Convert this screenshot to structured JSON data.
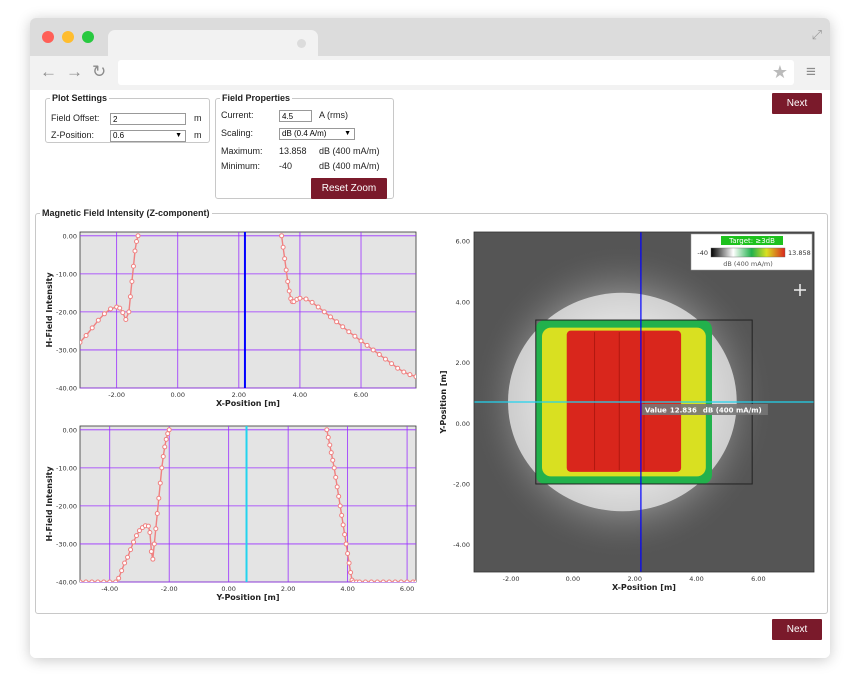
{
  "plot_settings": {
    "legend": "Plot Settings",
    "field_offset_label": "Field Offset:",
    "field_offset_value": "2",
    "field_offset_unit": "m",
    "z_position_label": "Z-Position:",
    "z_position_value": "0.6",
    "z_position_unit": "m"
  },
  "field_properties": {
    "legend": "Field Properties",
    "current_label": "Current:",
    "current_value": "4.5",
    "current_unit": "A (rms)",
    "scaling_label": "Scaling:",
    "scaling_value": "dB (0.4 A/m)",
    "maximum_label": "Maximum:",
    "maximum_value": "13.858",
    "maximum_unit": "dB (400 mA/m)",
    "minimum_label": "Minimum:",
    "minimum_value": "-40",
    "minimum_unit": "dB (400 mA/m)",
    "reset_zoom_label": "Reset Zoom"
  },
  "next_label": "Next",
  "chart_section": {
    "legend": "Magnetic Field Intensity (Z-component)"
  },
  "colors": {
    "button": "#7a1a2b",
    "curve": "#f08080",
    "grid": "#9b30ff",
    "cursor_x": "#0000ff",
    "cursor_y": "#22d3ee"
  },
  "icons": {
    "back": "back-arrow-icon",
    "forward": "forward-arrow-icon",
    "reload": "reload-icon",
    "star": "star-icon",
    "menu": "menu-icon",
    "expand": "expand-icon",
    "crosshair": "crosshair-icon"
  },
  "chart_data": [
    {
      "type": "line",
      "xlabel": "X-Position [m]",
      "ylabel": "H-Field Intensity",
      "xlim": [
        -3.2,
        7.8
      ],
      "ylim": [
        -40,
        1
      ],
      "xticks": [
        -2,
        0,
        2,
        4,
        6
      ],
      "xtick_labels": [
        "-2.00",
        "0.00",
        "2.00",
        "4.00",
        "6.00"
      ],
      "yticks": [
        0,
        -10,
        -20,
        -30,
        -40
      ],
      "ytick_labels": [
        "0.00",
        "-10.00",
        "-20.00",
        "-30.00",
        "-40.00"
      ],
      "grid": true,
      "cursor_x": 2.2,
      "series": [
        {
          "x": [
            -3.2,
            -3.0,
            -2.8,
            -2.6,
            -2.4,
            -2.2,
            -2.0,
            -1.9,
            -1.8,
            -1.7,
            -1.6,
            -1.55,
            -1.5,
            -1.45,
            -1.4,
            -1.35,
            -1.3
          ],
          "y": [
            -28,
            -26.2,
            -24.2,
            -22.2,
            -20.5,
            -19.2,
            -18.7,
            -19,
            -20.2,
            -22,
            -20,
            -16,
            -12,
            -8,
            -4,
            -1.5,
            0
          ]
        },
        {
          "x": [
            3.4,
            3.45,
            3.5,
            3.55,
            3.6,
            3.65,
            3.7,
            3.75,
            3.8,
            3.9,
            4.0,
            4.2,
            4.4,
            4.6,
            4.8,
            5.0,
            5.2,
            5.4,
            5.6,
            5.8,
            6.0,
            6.2,
            6.4,
            6.6,
            6.8,
            7.0,
            7.2,
            7.4,
            7.6,
            7.8
          ],
          "y": [
            0,
            -3,
            -6,
            -9,
            -12,
            -14.5,
            -16.5,
            -17.3,
            -17.3,
            -16.7,
            -16.4,
            -16.6,
            -17.5,
            -18.7,
            -20,
            -21.3,
            -22.6,
            -23.9,
            -25.2,
            -26.4,
            -27.6,
            -28.8,
            -30,
            -31.2,
            -32.4,
            -33.6,
            -34.8,
            -35.8,
            -36.5,
            -37
          ]
        }
      ]
    },
    {
      "type": "line",
      "xlabel": "Y-Position [m]",
      "ylabel": "H-Field Intensity",
      "xlim": [
        -5,
        6.3
      ],
      "ylim": [
        -40,
        1
      ],
      "xticks": [
        -4,
        -2,
        0,
        2,
        4,
        6
      ],
      "xtick_labels": [
        "-4.00",
        "-2.00",
        "0.00",
        "2.00",
        "4.00",
        "6.00"
      ],
      "yticks": [
        0,
        -10,
        -20,
        -30,
        -40
      ],
      "ytick_labels": [
        "0.00",
        "-10.00",
        "-20.00",
        "-30.00",
        "-40.00"
      ],
      "grid": true,
      "cursor_x": 0.6,
      "series": [
        {
          "x": [
            -5,
            -4.8,
            -4.6,
            -4.4,
            -4.2,
            -4.0,
            -3.8,
            -3.7,
            -3.6,
            -3.5,
            -3.4,
            -3.3,
            -3.2,
            -3.1,
            -3.0,
            -2.9,
            -2.8,
            -2.7,
            -2.65,
            -2.6,
            -2.55,
            -2.5,
            -2.45,
            -2.4,
            -2.35,
            -2.3,
            -2.25,
            -2.2,
            -2.15,
            -2.1,
            -2.05,
            -2.0
          ],
          "y": [
            -40,
            -40,
            -40,
            -40,
            -40,
            -40,
            -40,
            -39,
            -37,
            -35,
            -33.5,
            -31.5,
            -29.5,
            -27.8,
            -26.5,
            -25.7,
            -25.2,
            -25.3,
            -27,
            -32,
            -34,
            -30,
            -26,
            -22,
            -18,
            -14,
            -10,
            -7,
            -4.5,
            -2.5,
            -1,
            0
          ]
        },
        {
          "x": [
            3.3,
            3.35,
            3.4,
            3.45,
            3.5,
            3.55,
            3.6,
            3.65,
            3.7,
            3.75,
            3.8,
            3.85,
            3.9,
            3.95,
            4.0,
            4.05,
            4.1,
            4.15,
            4.2,
            4.3,
            4.4,
            4.6,
            4.8,
            5.0,
            5.2,
            5.4,
            5.6,
            5.8,
            6.0,
            6.2,
            6.3
          ],
          "y": [
            0,
            -2,
            -4,
            -6,
            -8,
            -10,
            -12.5,
            -15,
            -17.5,
            -20,
            -22.5,
            -25,
            -27.5,
            -30,
            -32.5,
            -35,
            -37.5,
            -39.5,
            -40,
            -40,
            -40,
            -40,
            -40,
            -40,
            -40,
            -40,
            -40,
            -40,
            -40,
            -40,
            -40
          ]
        }
      ]
    },
    {
      "type": "heatmap",
      "xlabel": "X-Position [m]",
      "ylabel": "Y-Position [m]",
      "xlim": [
        -3.2,
        7.8
      ],
      "ylim": [
        -4.9,
        6.3
      ],
      "xticks": [
        -2,
        0,
        2,
        4,
        6
      ],
      "xtick_labels": [
        "-2.00",
        "0.00",
        "2.00",
        "4.00",
        "6.00"
      ],
      "yticks": [
        6,
        4,
        2,
        0,
        -2,
        -4
      ],
      "ytick_labels": [
        "6.00",
        "4.00",
        "2.00",
        "0.00",
        "-2.00",
        "-4.00"
      ],
      "cursor_x": 2.2,
      "cursor_y": 0.7,
      "selection_box": {
        "x0": -1.2,
        "x1": 5.8,
        "y0": -2.0,
        "y1": 3.4
      },
      "regions": [
        {
          "name": "green",
          "x0": -1.2,
          "x1": 4.5,
          "y0": -2.0,
          "y1": 3.4,
          "color": "#22b14c"
        },
        {
          "name": "yellow",
          "x0": -1.0,
          "x1": 4.3,
          "y0": -1.75,
          "y1": 3.15,
          "color": "#d9e021"
        },
        {
          "name": "red",
          "x0": -0.2,
          "x1": 3.5,
          "y0": -1.6,
          "y1": 3.05,
          "color": "#d9261c"
        }
      ],
      "legend": {
        "title": "Target: ≥3dB",
        "min_label": "-40",
        "max_label": "13.858",
        "unit": "dB (400 mA/m)"
      },
      "tooltip": {
        "label": "Value",
        "value": "12.836",
        "unit": "dB (400 mA/m)"
      }
    }
  ]
}
